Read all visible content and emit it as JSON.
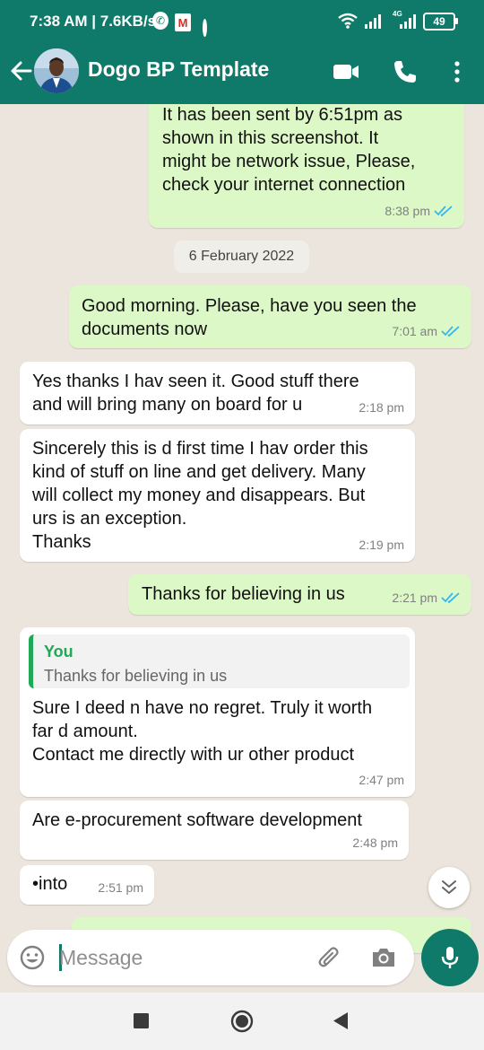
{
  "status_bar": {
    "time": "7:38 AM | 7.6KB/s",
    "whatsapp_badge": "✆",
    "gmail_badge": "M",
    "network_label": "4G",
    "battery": "49"
  },
  "header": {
    "title": "Dogo BP Template",
    "accent_color": "#0f7a69"
  },
  "date_separator": "6 February 2022",
  "messages": [
    {
      "direction": "outgoing",
      "text": "It has been sent by 6:51pm as\nshown in this screenshot. It\nmight be network issue, Please,\ncheck your internet connection",
      "time": "8:38 pm",
      "status": "read"
    },
    {
      "direction": "outgoing",
      "text": "Good morning. Please, have you seen the\ndocuments now",
      "time": "7:01 am",
      "status": "read"
    },
    {
      "direction": "incoming",
      "text": "Yes thanks I hav seen it. Good stuff there\nand will bring many on board for u",
      "time": "2:18 pm"
    },
    {
      "direction": "incoming",
      "text": "Sincerely this is d first time I hav order this\nkind of stuff on line and get delivery. Many\nwill collect my money and disappears. But\nurs is an exception.\nThanks",
      "time": "2:19 pm"
    },
    {
      "direction": "outgoing",
      "text": "Thanks for believing in us",
      "time": "2:21 pm",
      "status": "read"
    },
    {
      "direction": "incoming",
      "quote": {
        "author": "You",
        "text": "Thanks for believing in us"
      },
      "text": "Sure I deed n have no regret. Truly it worth\nfar d amount.\nContact me directly with ur other product",
      "time": "2:47 pm"
    },
    {
      "direction": "incoming",
      "text": "Are e-procurement software development",
      "time": "2:48 pm"
    },
    {
      "direction": "incoming",
      "text": "•into",
      "time": "2:51 pm"
    }
  ],
  "composer": {
    "placeholder": "Message"
  },
  "icons": {
    "back": "back-arrow-icon",
    "video": "video-call-icon",
    "call": "phone-icon",
    "menu": "more-vert-icon",
    "emoji": "emoji-icon",
    "attach": "paperclip-icon",
    "camera": "camera-icon",
    "mic": "mic-icon",
    "scroll": "double-chevron-down-icon"
  }
}
